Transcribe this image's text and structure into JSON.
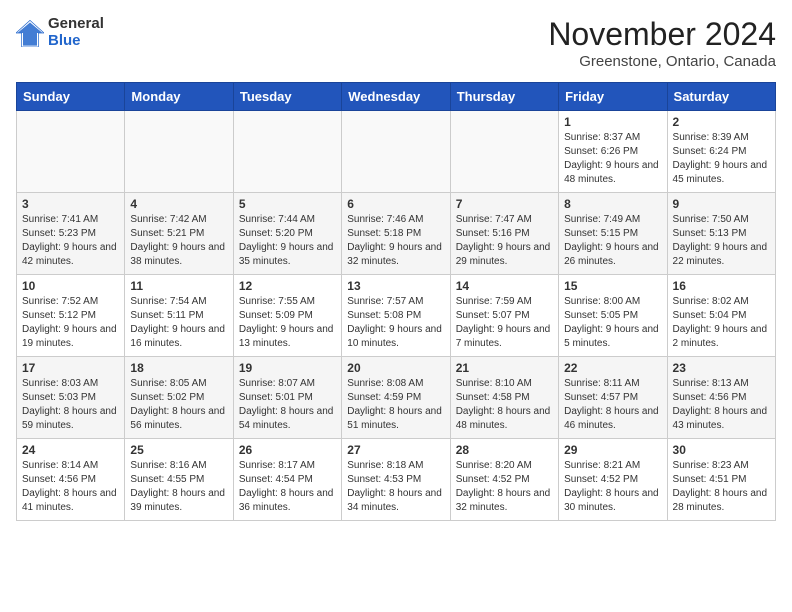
{
  "logo": {
    "general": "General",
    "blue": "Blue"
  },
  "title": "November 2024",
  "location": "Greenstone, Ontario, Canada",
  "days_header": [
    "Sunday",
    "Monday",
    "Tuesday",
    "Wednesday",
    "Thursday",
    "Friday",
    "Saturday"
  ],
  "weeks": [
    [
      {
        "day": "",
        "info": ""
      },
      {
        "day": "",
        "info": ""
      },
      {
        "day": "",
        "info": ""
      },
      {
        "day": "",
        "info": ""
      },
      {
        "day": "",
        "info": ""
      },
      {
        "day": "1",
        "info": "Sunrise: 8:37 AM\nSunset: 6:26 PM\nDaylight: 9 hours and 48 minutes."
      },
      {
        "day": "2",
        "info": "Sunrise: 8:39 AM\nSunset: 6:24 PM\nDaylight: 9 hours and 45 minutes."
      }
    ],
    [
      {
        "day": "3",
        "info": "Sunrise: 7:41 AM\nSunset: 5:23 PM\nDaylight: 9 hours and 42 minutes."
      },
      {
        "day": "4",
        "info": "Sunrise: 7:42 AM\nSunset: 5:21 PM\nDaylight: 9 hours and 38 minutes."
      },
      {
        "day": "5",
        "info": "Sunrise: 7:44 AM\nSunset: 5:20 PM\nDaylight: 9 hours and 35 minutes."
      },
      {
        "day": "6",
        "info": "Sunrise: 7:46 AM\nSunset: 5:18 PM\nDaylight: 9 hours and 32 minutes."
      },
      {
        "day": "7",
        "info": "Sunrise: 7:47 AM\nSunset: 5:16 PM\nDaylight: 9 hours and 29 minutes."
      },
      {
        "day": "8",
        "info": "Sunrise: 7:49 AM\nSunset: 5:15 PM\nDaylight: 9 hours and 26 minutes."
      },
      {
        "day": "9",
        "info": "Sunrise: 7:50 AM\nSunset: 5:13 PM\nDaylight: 9 hours and 22 minutes."
      }
    ],
    [
      {
        "day": "10",
        "info": "Sunrise: 7:52 AM\nSunset: 5:12 PM\nDaylight: 9 hours and 19 minutes."
      },
      {
        "day": "11",
        "info": "Sunrise: 7:54 AM\nSunset: 5:11 PM\nDaylight: 9 hours and 16 minutes."
      },
      {
        "day": "12",
        "info": "Sunrise: 7:55 AM\nSunset: 5:09 PM\nDaylight: 9 hours and 13 minutes."
      },
      {
        "day": "13",
        "info": "Sunrise: 7:57 AM\nSunset: 5:08 PM\nDaylight: 9 hours and 10 minutes."
      },
      {
        "day": "14",
        "info": "Sunrise: 7:59 AM\nSunset: 5:07 PM\nDaylight: 9 hours and 7 minutes."
      },
      {
        "day": "15",
        "info": "Sunrise: 8:00 AM\nSunset: 5:05 PM\nDaylight: 9 hours and 5 minutes."
      },
      {
        "day": "16",
        "info": "Sunrise: 8:02 AM\nSunset: 5:04 PM\nDaylight: 9 hours and 2 minutes."
      }
    ],
    [
      {
        "day": "17",
        "info": "Sunrise: 8:03 AM\nSunset: 5:03 PM\nDaylight: 8 hours and 59 minutes."
      },
      {
        "day": "18",
        "info": "Sunrise: 8:05 AM\nSunset: 5:02 PM\nDaylight: 8 hours and 56 minutes."
      },
      {
        "day": "19",
        "info": "Sunrise: 8:07 AM\nSunset: 5:01 PM\nDaylight: 8 hours and 54 minutes."
      },
      {
        "day": "20",
        "info": "Sunrise: 8:08 AM\nSunset: 4:59 PM\nDaylight: 8 hours and 51 minutes."
      },
      {
        "day": "21",
        "info": "Sunrise: 8:10 AM\nSunset: 4:58 PM\nDaylight: 8 hours and 48 minutes."
      },
      {
        "day": "22",
        "info": "Sunrise: 8:11 AM\nSunset: 4:57 PM\nDaylight: 8 hours and 46 minutes."
      },
      {
        "day": "23",
        "info": "Sunrise: 8:13 AM\nSunset: 4:56 PM\nDaylight: 8 hours and 43 minutes."
      }
    ],
    [
      {
        "day": "24",
        "info": "Sunrise: 8:14 AM\nSunset: 4:56 PM\nDaylight: 8 hours and 41 minutes."
      },
      {
        "day": "25",
        "info": "Sunrise: 8:16 AM\nSunset: 4:55 PM\nDaylight: 8 hours and 39 minutes."
      },
      {
        "day": "26",
        "info": "Sunrise: 8:17 AM\nSunset: 4:54 PM\nDaylight: 8 hours and 36 minutes."
      },
      {
        "day": "27",
        "info": "Sunrise: 8:18 AM\nSunset: 4:53 PM\nDaylight: 8 hours and 34 minutes."
      },
      {
        "day": "28",
        "info": "Sunrise: 8:20 AM\nSunset: 4:52 PM\nDaylight: 8 hours and 32 minutes."
      },
      {
        "day": "29",
        "info": "Sunrise: 8:21 AM\nSunset: 4:52 PM\nDaylight: 8 hours and 30 minutes."
      },
      {
        "day": "30",
        "info": "Sunrise: 8:23 AM\nSunset: 4:51 PM\nDaylight: 8 hours and 28 minutes."
      }
    ]
  ]
}
